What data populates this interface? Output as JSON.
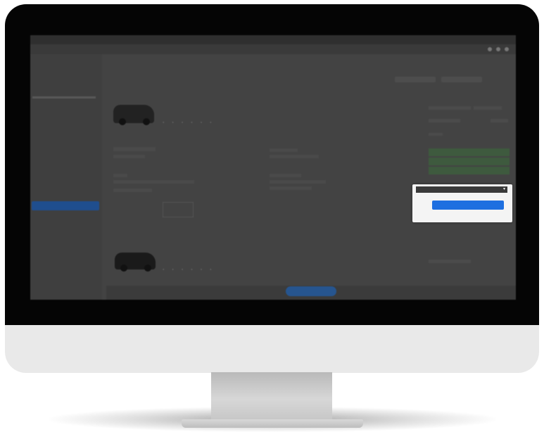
{
  "browser": {
    "address": "",
    "bookmarks": [
      "",
      "",
      "",
      "",
      "",
      "",
      "",
      "",
      "",
      "",
      "",
      "",
      ""
    ]
  },
  "page": {
    "heading": "",
    "controls": [
      "",
      ""
    ]
  },
  "sidebar": {
    "filters": [
      "",
      "",
      "",
      "",
      "",
      "",
      "",
      "",
      "",
      "",
      "",
      "",
      "",
      "",
      "",
      "",
      "",
      "",
      ""
    ],
    "button_label": ""
  },
  "cars": [
    {
      "title": "",
      "subtitle": "",
      "features": [
        "",
        "",
        "",
        "",
        "",
        ""
      ]
    },
    {
      "title": "",
      "subtitle": "",
      "features": [
        "",
        "",
        "",
        "",
        "",
        ""
      ]
    }
  ],
  "details": {
    "rating_label": "",
    "rating_value": "",
    "brand": "",
    "brand_text": ""
  },
  "price_panel": {
    "lines": [
      "",
      "",
      "",
      "",
      "",
      "",
      "",
      "",
      ""
    ]
  },
  "popup": {
    "select_value": "",
    "pay_button": "",
    "note": ""
  },
  "bottom_bar": {
    "text": "",
    "button": "",
    "text_2": ""
  },
  "colors": {
    "accent": "#1e6fe0",
    "screen_dim": "#434343",
    "monitor_bezel": "#050505",
    "monitor_chin": "#e9e9e9"
  }
}
